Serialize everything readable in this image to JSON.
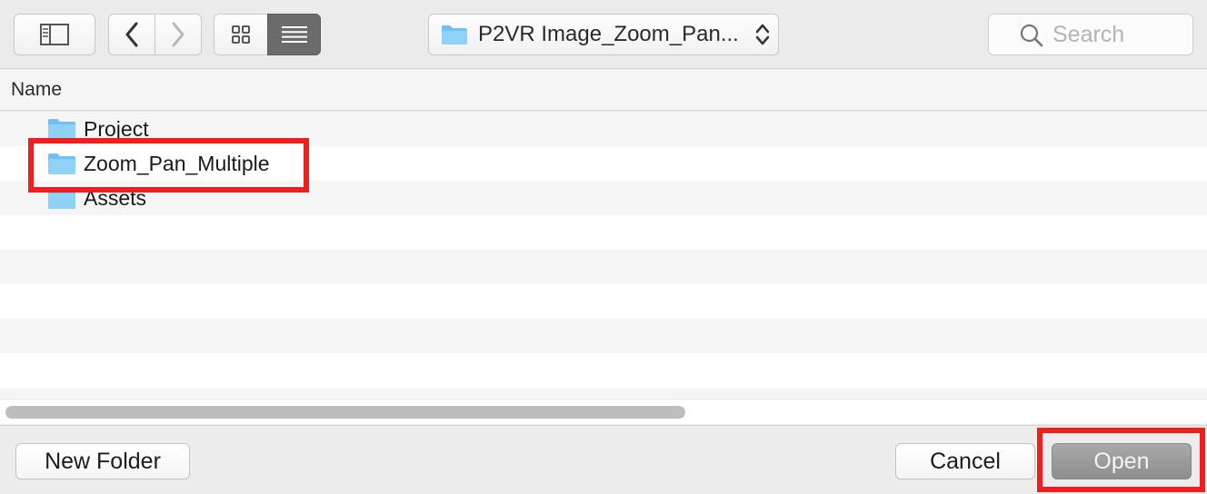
{
  "toolbar": {
    "sidebar_icon": "sidebar-toggle-icon",
    "back_icon": "chevron-left-icon",
    "forward_icon": "chevron-right-icon",
    "icon_view_icon": "grid-icon",
    "list_view_icon": "list-icon",
    "path_label": "P2VR Image_Zoom_Pan...",
    "search_placeholder": "Search"
  },
  "columns": {
    "name": "Name"
  },
  "files": [
    {
      "label": "Project",
      "icon": "folder-icon"
    },
    {
      "label": "Zoom_Pan_Multiple",
      "icon": "folder-icon"
    },
    {
      "label": "Assets",
      "icon": "folder-icon"
    }
  ],
  "buttons": {
    "new_folder": "New Folder",
    "cancel": "Cancel",
    "open": "Open"
  },
  "colors": {
    "folder": "#6ec1f2",
    "highlight": "#ee1f1f",
    "selected_view": "#6b6b6b"
  }
}
